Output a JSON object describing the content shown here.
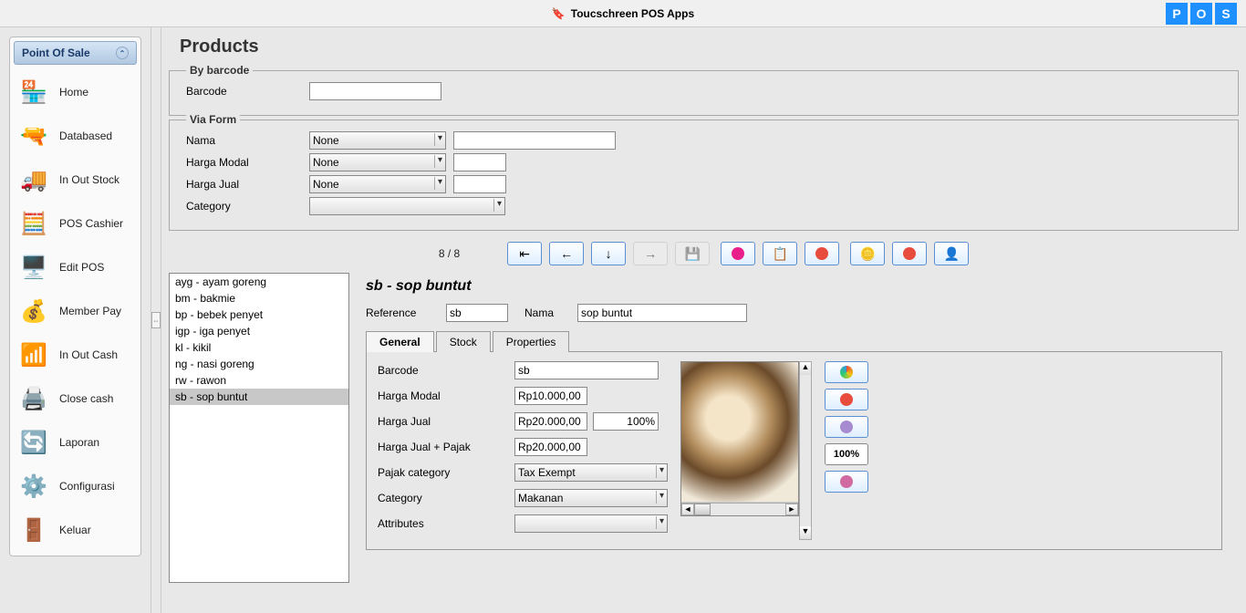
{
  "app": {
    "title": "Toucschreen POS Apps",
    "badges": [
      "P",
      "O",
      "S"
    ]
  },
  "sidebar": {
    "header": "Point Of Sale",
    "items": [
      {
        "label": "Home",
        "icon": "🏪"
      },
      {
        "label": "Databased",
        "icon": "🔫"
      },
      {
        "label": "In Out Stock",
        "icon": "🚚"
      },
      {
        "label": "POS Cashier",
        "icon": "🧮"
      },
      {
        "label": "Edit POS",
        "icon": "🖥️"
      },
      {
        "label": "Member Pay",
        "icon": "💰"
      },
      {
        "label": "In Out Cash",
        "icon": "📶"
      },
      {
        "label": "Close cash",
        "icon": "🖨️"
      },
      {
        "label": "Laporan",
        "icon": "🔄"
      },
      {
        "label": "Configurasi",
        "icon": "⚙️"
      },
      {
        "label": "Keluar",
        "icon": "🚪"
      }
    ]
  },
  "page": {
    "title": "Products"
  },
  "barcode_section": {
    "legend": "By barcode",
    "label": "Barcode",
    "value": ""
  },
  "form_section": {
    "legend": "Via Form",
    "nama_label": "Nama",
    "nama_op": "None",
    "nama_val": "",
    "hmodal_label": "Harga Modal",
    "hmodal_op": "None",
    "hmodal_val": "",
    "hjual_label": "Harga Jual",
    "hjual_op": "None",
    "hjual_val": "",
    "cat_label": "Category",
    "cat_val": ""
  },
  "pager": {
    "text": "8 / 8"
  },
  "product_list": [
    "ayg - ayam goreng",
    "bm - bakmie",
    "bp - bebek penyet",
    "igp - iga penyet",
    "kl - kikil",
    "ng - nasi goreng",
    "rw - rawon",
    "sb - sop buntut"
  ],
  "product_list_selected": 7,
  "detail": {
    "title": "sb - sop buntut",
    "ref_label": "Reference",
    "ref": "sb",
    "nama_label": "Nama",
    "nama": "sop buntut",
    "tabs": [
      "General",
      "Stock",
      "Properties"
    ],
    "active_tab": 0,
    "fields": {
      "barcode_l": "Barcode",
      "barcode": "sb",
      "hmodal_l": "Harga Modal",
      "hmodal": "Rp10.000,00",
      "hjual_l": "Harga Jual",
      "hjual": "Rp20.000,00",
      "hjual_pct": "100%",
      "hjualp_l": "Harga Jual + Pajak",
      "hjualp": "Rp20.000,00",
      "pajak_l": "Pajak category",
      "pajak": "Tax Exempt",
      "cat_l": "Category",
      "cat": "Makanan",
      "attr_l": "Attributes",
      "attr": ""
    },
    "btn100": "100%"
  }
}
